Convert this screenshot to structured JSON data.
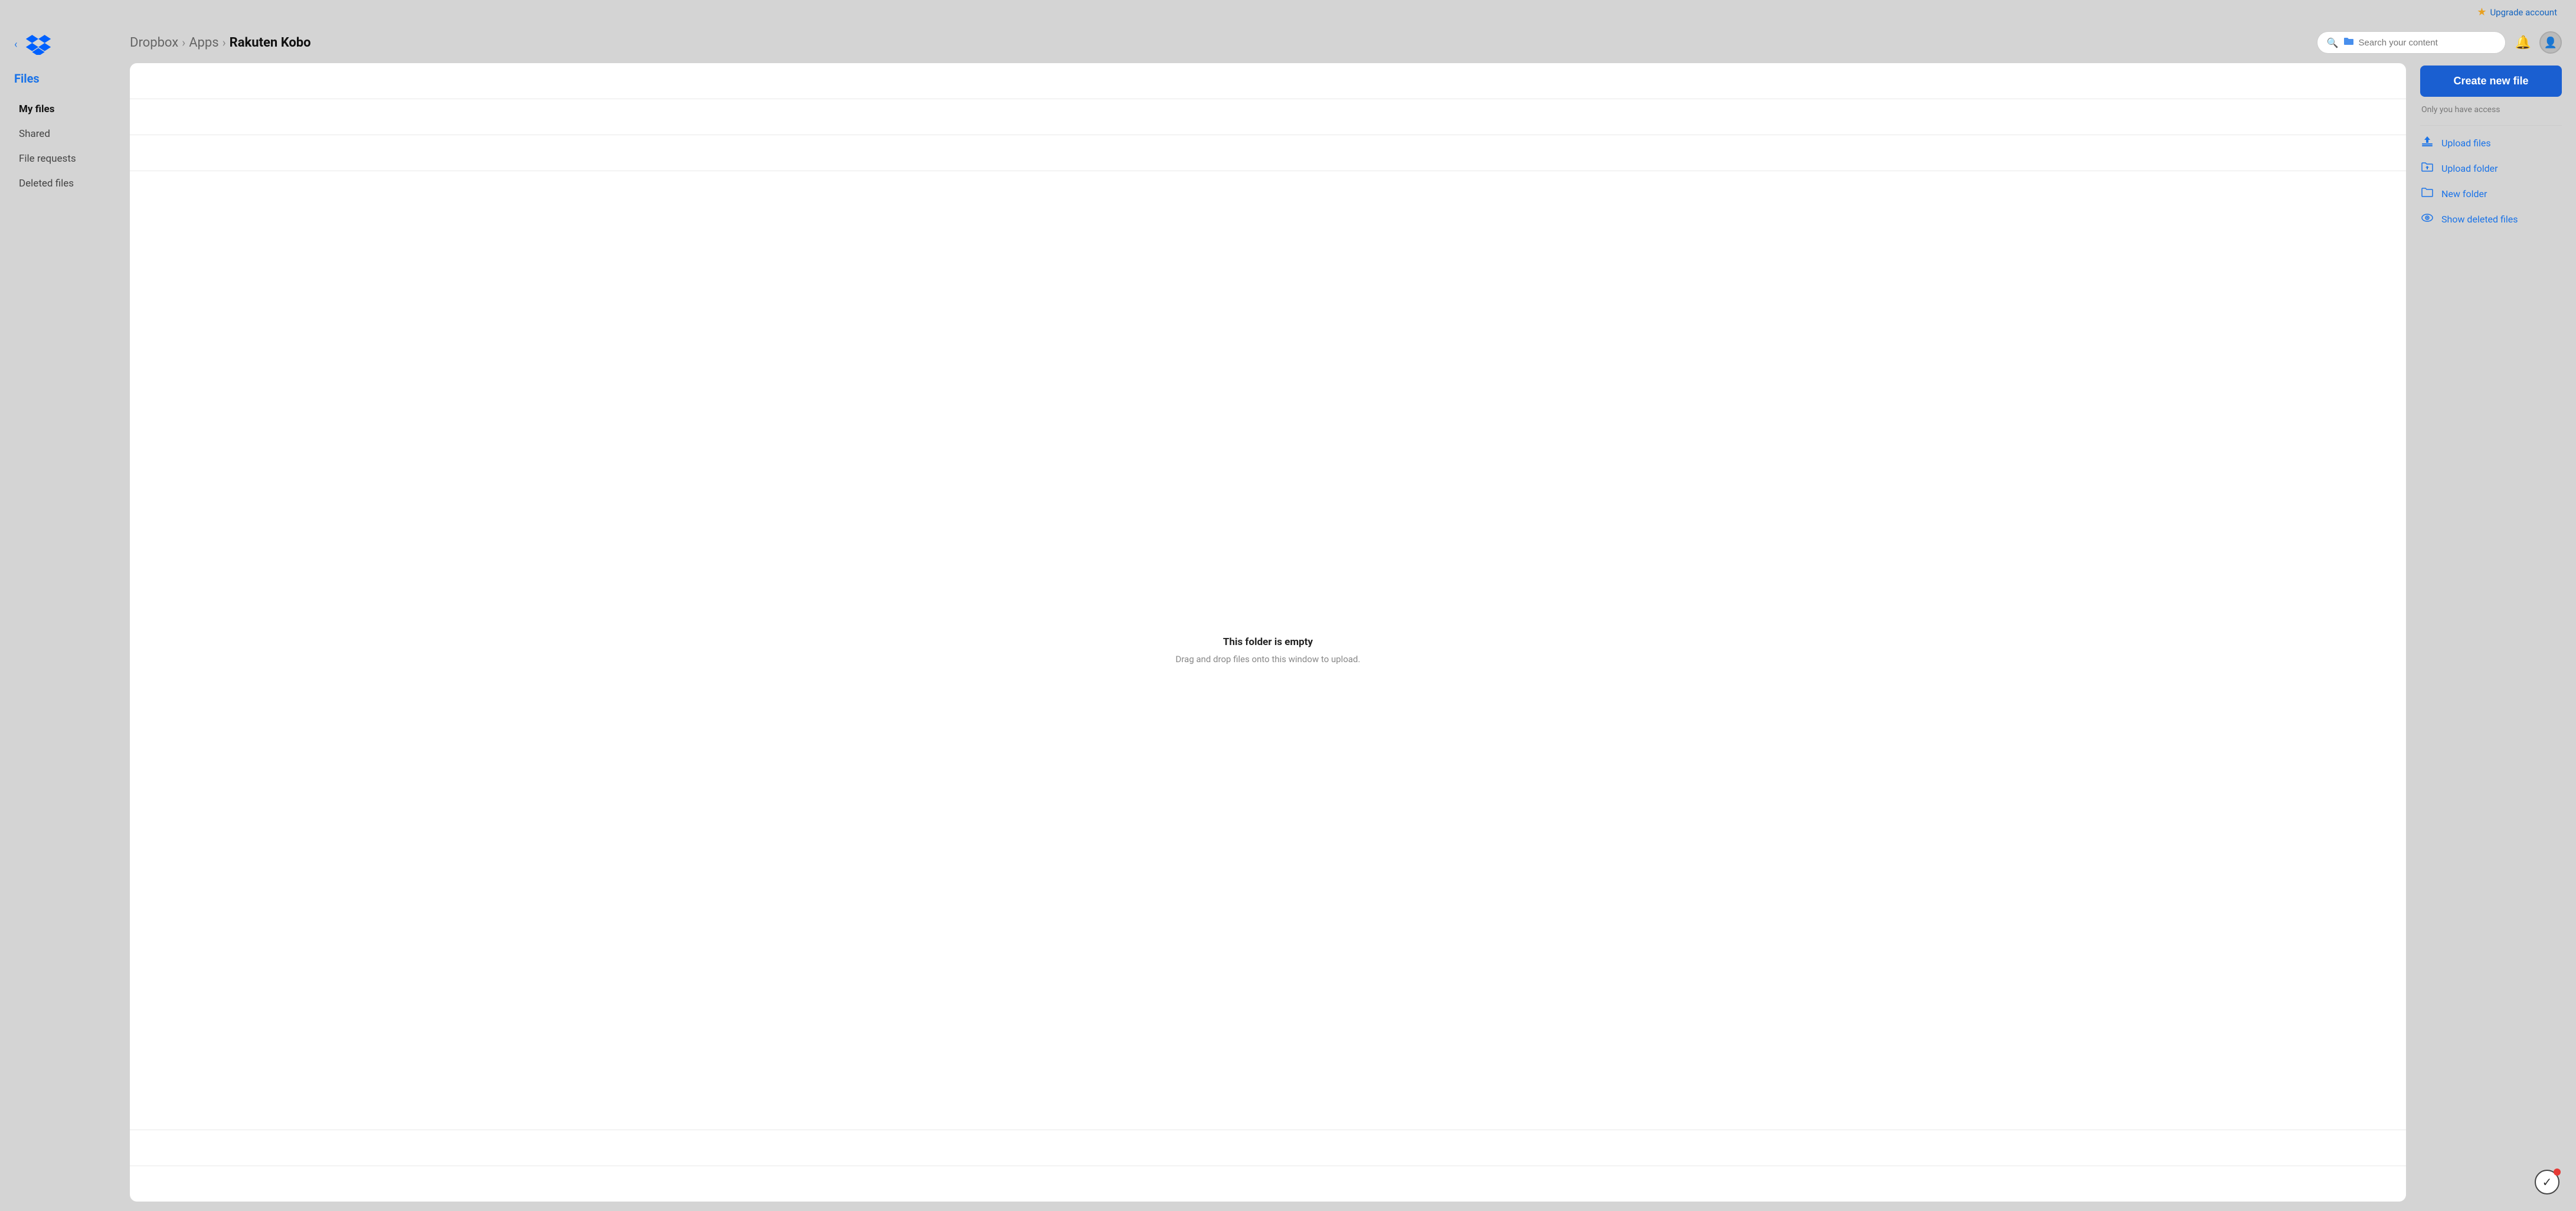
{
  "topbar": {
    "upgrade_label": "Upgrade account"
  },
  "sidebar": {
    "section_title": "Files",
    "nav_items": [
      {
        "label": "My files",
        "active": true
      },
      {
        "label": "Shared",
        "active": false
      },
      {
        "label": "File requests",
        "active": false
      },
      {
        "label": "Deleted files",
        "active": false
      }
    ]
  },
  "header": {
    "breadcrumb": {
      "part1": "Dropbox",
      "sep1": "›",
      "part2": "Apps",
      "sep2": "›",
      "part3": "Rakuten Kobo"
    },
    "search_placeholder": "Search your content"
  },
  "main": {
    "empty_title": "This folder is empty",
    "empty_subtitle": "Drag and drop files onto this window to upload."
  },
  "right_panel": {
    "create_button": "Create new file",
    "access_info": "Only you have access",
    "actions": [
      {
        "label": "Upload files",
        "icon": "upload-file"
      },
      {
        "label": "Upload folder",
        "icon": "upload-folder"
      },
      {
        "label": "New folder",
        "icon": "new-folder"
      },
      {
        "label": "Show deleted files",
        "icon": "show-deleted"
      }
    ]
  }
}
